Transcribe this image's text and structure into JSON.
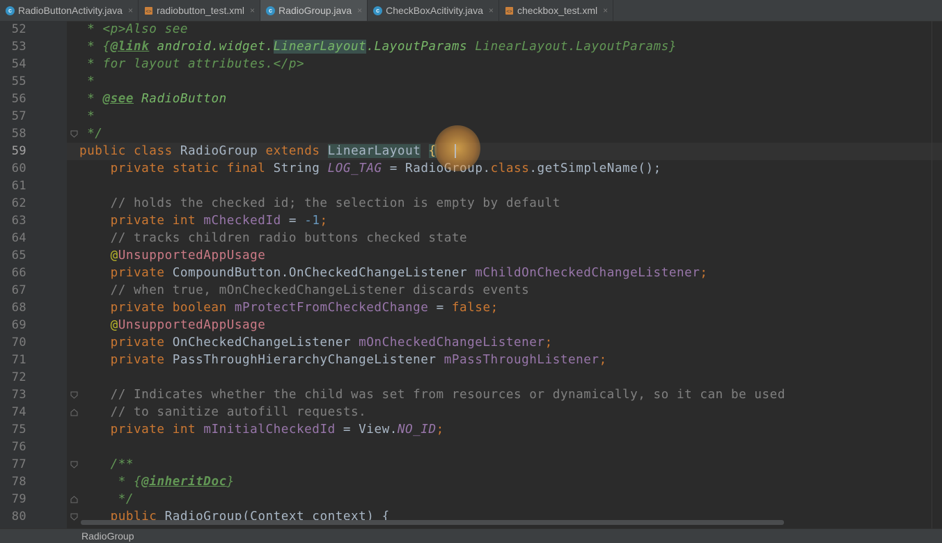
{
  "tabs": [
    {
      "label": "RadioButtonActivity.java",
      "type": "java",
      "active": false
    },
    {
      "label": "radiobutton_test.xml",
      "type": "xml",
      "active": false
    },
    {
      "label": "RadioGroup.java",
      "type": "java",
      "active": true
    },
    {
      "label": "CheckBoxAcitivity.java",
      "type": "java",
      "active": false
    },
    {
      "label": "checkbox_test.xml",
      "type": "xml",
      "active": false
    }
  ],
  "tab_close_glyph": "×",
  "java_icon_letter": "c",
  "line_numbers": [
    "52",
    "53",
    "54",
    "55",
    "56",
    "57",
    "58",
    "59",
    "60",
    "61",
    "62",
    "63",
    "64",
    "65",
    "66",
    "67",
    "68",
    "69",
    "70",
    "71",
    "72",
    "73",
    "74",
    "75",
    "76",
    "77",
    "78",
    "79",
    "80"
  ],
  "current_line": "59",
  "code": {
    "l52": {
      "star": " * ",
      "tag": "<p>",
      "text": "Also see"
    },
    "l53": {
      "star": " * ",
      "open": "{",
      "link": "@link",
      "pkg": " android.widget.",
      "cls": "LinearLayout",
      "rest": ".LayoutParams",
      "label": " LinearLayout.LayoutParams",
      "close": "}"
    },
    "l54": {
      "star": " * ",
      "text": "for layout attributes.",
      "tag": "</p>"
    },
    "l55": {
      "star": " *"
    },
    "l56": {
      "star": " * ",
      "see": "@see",
      "text": " RadioButton"
    },
    "l57": {
      "star": " *"
    },
    "l58": {
      "text": " */"
    },
    "l59": {
      "kw1": "public",
      "kw2": "class",
      "name": "RadioGroup",
      "kw3": "extends",
      "parent": "LinearLayout",
      "brace": "{"
    },
    "l60": {
      "kw": "private static final",
      "type": "String",
      "const": "LOG_TAG",
      "eq": " = ",
      "expr": "RadioGroup.",
      "kwclass": "class",
      "call": ".getSimpleName();"
    },
    "l62": {
      "comment": "// holds the checked id; the selection is empty by default"
    },
    "l63": {
      "kw": "private int",
      "field": "mCheckedId",
      "rest": " = ",
      "num": "-1",
      "semi": ";"
    },
    "l64": {
      "comment": "// tracks children radio buttons checked state"
    },
    "l65": {
      "at": "@",
      "ann": "UnsupportedAppUsage"
    },
    "l66": {
      "kw": "private",
      "type": " CompoundButton.OnCheckedChangeListener ",
      "field": "mChildOnCheckedChangeListener",
      "semi": ";"
    },
    "l67": {
      "comment": "// when true, mOnCheckedChangeListener discards events"
    },
    "l68": {
      "kw": "private boolean",
      "field": "mProtectFromCheckedChange",
      "eq": " = ",
      "val": "false",
      "semi": ";"
    },
    "l69": {
      "at": "@",
      "ann": "UnsupportedAppUsage"
    },
    "l70": {
      "kw": "private",
      "type": " OnCheckedChangeListener ",
      "field": "mOnCheckedChangeListener",
      "semi": ";"
    },
    "l71": {
      "kw": "private",
      "type": " PassThroughHierarchyChangeListener ",
      "field": "mPassThroughListener",
      "semi": ";"
    },
    "l73": {
      "comment": "// Indicates whether the child was set from resources or dynamically, so it can be used"
    },
    "l74": {
      "comment": "// to sanitize autofill requests."
    },
    "l75": {
      "kw": "private int",
      "field": "mInitialCheckedId",
      "eq": " = View.",
      "const": "NO_ID",
      "semi": ";"
    },
    "l77": {
      "text": "/**"
    },
    "l78": {
      "star": " * ",
      "open": "{",
      "tag": "@inheritDoc",
      "close": "}"
    },
    "l79": {
      "text": " */"
    },
    "l80": {
      "kw": "public",
      "name": "RadioGroup",
      "rest": "(Context context) {"
    }
  },
  "status": {
    "breadcrumb": "RadioGroup"
  },
  "colors": {
    "background": "#2b2b2b",
    "keyword": "#cc7832",
    "comment": "#808080",
    "javadoc": "#629755",
    "field": "#9876aa",
    "number": "#6897bb",
    "annotation": "#bbb529"
  }
}
